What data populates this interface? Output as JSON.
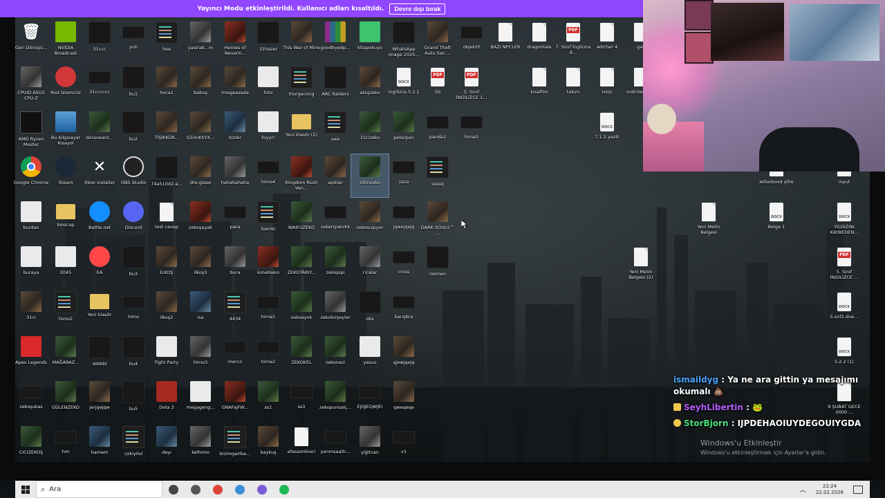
{
  "banner": {
    "text": "Yayıncı Modu etkinleştirildi. Kullanıcı adları kısaltıldı.",
    "button": "Devre dışı bırak"
  },
  "colors": {
    "banner": "#9146ff",
    "taskbar": "#e9e9ea"
  },
  "desktop": {
    "icons": [
      {
        "label": "Geri Dönüşü...",
        "icon": "recycle-bin-icon",
        "type": "recycle"
      },
      {
        "label": "NVIDIA Broadcast",
        "icon": "nvidia-icon",
        "type": "nvidia"
      },
      {
        "label": "31ccc",
        "icon": "image-icon",
        "type": "dark"
      },
      {
        "label": "yuh",
        "icon": "image-icon",
        "type": "small"
      },
      {
        "label": "hee",
        "icon": "image-icon",
        "type": "code"
      },
      {
        "label": "yasirab...m",
        "icon": "image-icon",
        "type": "gray"
      },
      {
        "label": "Heroes of Neverti...",
        "icon": "game-icon",
        "type": "red"
      },
      {
        "label": "31hazer",
        "icon": "image-icon",
        "type": "dark"
      },
      {
        "label": "This War of Mine",
        "icon": "game-icon",
        "type": "photo"
      },
      {
        "label": "goodbyedp...",
        "icon": "archive-icon",
        "type": "rar"
      },
      {
        "label": "kitapokuyo",
        "icon": "image-icon",
        "type": "green2"
      },
      {
        "label": "WhatsApp Image 2025...",
        "icon": "image-icon",
        "type": "dark"
      },
      {
        "label": "Grand Theft Auto San ...",
        "icon": "game-icon",
        "type": "photo"
      },
      {
        "label": "objektif",
        "icon": "image-icon",
        "type": "small"
      },
      {
        "label": "BAZI NPCLER",
        "icon": "document-icon",
        "type": "doc"
      },
      {
        "label": "dragontale",
        "icon": "document-icon",
        "type": "doc"
      },
      {
        "label": "7. Sınıf İngilizce 8...",
        "icon": "pdf-icon",
        "type": "pdf"
      },
      {
        "label": "witcher 4",
        "icon": "document-icon",
        "type": "doc"
      },
      {
        "label": "gay",
        "icon": "document-icon",
        "type": "doc"
      },
      {
        "label": "CPUID ASUS CPU-Z",
        "icon": "cpuz-icon",
        "type": "gray"
      },
      {
        "label": "Riot İstemcisi",
        "icon": "riot-icon",
        "type": "riot"
      },
      {
        "label": "31cccccc",
        "icon": "image-icon",
        "type": "small"
      },
      {
        "label": "bu1",
        "icon": "image-icon",
        "type": "dark"
      },
      {
        "label": "hoca1",
        "icon": "image-icon",
        "type": "photo"
      },
      {
        "label": "babuş",
        "icon": "image-icon",
        "type": "photo"
      },
      {
        "label": "imageasada",
        "icon": "image-icon",
        "type": "photo"
      },
      {
        "label": "foto",
        "icon": "image-icon",
        "type": "white"
      },
      {
        "label": "thorgecmig",
        "icon": "image-icon",
        "type": "code"
      },
      {
        "label": "ARC Raiders",
        "icon": "game-icon",
        "type": "dark"
      },
      {
        "label": "ateşzeko",
        "icon": "image-icon",
        "type": "photo"
      },
      {
        "label": "ingilizce.5.2.1",
        "icon": "docx-icon",
        "type": "docx"
      },
      {
        "label": "5b",
        "icon": "pdf-icon",
        "type": "pdf"
      },
      {
        "label": "5. Sınıf İNGİLİZCE 1...",
        "icon": "pdf-icon",
        "type": "pdf"
      },
      {
        "label": "kısafilm",
        "icon": "document-icon",
        "type": "doc"
      },
      {
        "label": "takım",
        "icon": "document-icon",
        "type": "doc"
      },
      {
        "label": "lolrp",
        "icon": "document-icon",
        "type": "doc"
      },
      {
        "label": "indirilen liste",
        "icon": "document-icon",
        "type": "doc"
      },
      {
        "label": "AMD Ryzen Master",
        "icon": "amd-icon",
        "type": "amd"
      },
      {
        "label": "Bu bilgisayar Kısayol",
        "icon": "computer-icon",
        "type": "bluebar"
      },
      {
        "label": "doraveant...",
        "icon": "image-icon",
        "type": "green"
      },
      {
        "label": "bu2",
        "icon": "image-icon",
        "type": "dark"
      },
      {
        "label": "TİŞİKKÜR...",
        "icon": "image-icon",
        "type": "photo"
      },
      {
        "label": "G50nKhYX...",
        "icon": "image-icon",
        "type": "photo"
      },
      {
        "label": "bizler",
        "icon": "image-icon",
        "type": "blue"
      },
      {
        "label": "foyyr!",
        "icon": "image-icon",
        "type": "white"
      },
      {
        "label": "Yeni klasör (2)",
        "icon": "folder-icon",
        "type": "folder"
      },
      {
        "label": "aaa",
        "icon": "image-icon",
        "type": "code"
      },
      {
        "label": "31cizeko",
        "icon": "image-icon",
        "type": "green"
      },
      {
        "label": "peterpan",
        "icon": "image-icon",
        "type": "green"
      },
      {
        "label": "panda1",
        "icon": "image-icon",
        "type": "small"
      },
      {
        "label": "hima5",
        "icon": "image-icon",
        "type": "small"
      },
      {
        "label": "7.1.2.yazili",
        "icon": "docx-icon",
        "type": "docx"
      },
      {
        "label": "Google Chrome",
        "icon": "chrome-icon",
        "type": "chrome"
      },
      {
        "label": "Steam",
        "icon": "steam-icon",
        "type": "steam"
      },
      {
        "label": "Xbox installer",
        "icon": "xbox-icon",
        "type": "xbox"
      },
      {
        "label": "OBS Studio",
        "icon": "obs-icon",
        "type": "obs"
      },
      {
        "label": "74a510d2-a...",
        "icon": "image-icon",
        "type": "dark"
      },
      {
        "label": "dre-glase",
        "icon": "image-icon",
        "type": "photo"
      },
      {
        "label": "hahahahaha",
        "icon": "image-icon",
        "type": "gray"
      },
      {
        "label": "himo4",
        "icon": "image-icon",
        "type": "small"
      },
      {
        "label": "Kingdom Rush Ven...",
        "icon": "game-icon",
        "type": "red"
      },
      {
        "label": "aşıklar",
        "icon": "image-icon",
        "type": "photo"
      },
      {
        "label": "zibinzeko",
        "icon": "image-icon",
        "type": "green",
        "selected": true
      },
      {
        "label": "zaza",
        "icon": "image-icon",
        "type": "small"
      },
      {
        "label": "ssssq",
        "icon": "image-icon",
        "type": "code"
      },
      {
        "label": "letterboxd şifre",
        "icon": "document-icon",
        "type": "doc"
      },
      {
        "label": "input",
        "icon": "document-icon",
        "type": "doc"
      },
      {
        "label": "burdan",
        "icon": "image-icon",
        "type": "white"
      },
      {
        "label": "bioscap",
        "icon": "folder-icon",
        "type": "folder"
      },
      {
        "label": "Battle.net",
        "icon": "battlenet-icon",
        "type": "battle"
      },
      {
        "label": "Discord",
        "icon": "discord-icon",
        "type": "discord"
      },
      {
        "label": "test cevap",
        "icon": "document-icon",
        "type": "doc"
      },
      {
        "label": "zekoşayak",
        "icon": "image-icon",
        "type": "red"
      },
      {
        "label": "para",
        "icon": "image-icon",
        "type": "small"
      },
      {
        "label": "bambi",
        "icon": "image-icon",
        "type": "code"
      },
      {
        "label": "WAIFUZEKO",
        "icon": "image-icon",
        "type": "green"
      },
      {
        "label": "zekeriyakvkk",
        "icon": "image-icon",
        "type": "small"
      },
      {
        "label": "zekosuipyor",
        "icon": "image-icon",
        "type": "photo"
      },
      {
        "label": "jqwejqejq",
        "icon": "image-icon",
        "type": "small"
      },
      {
        "label": "DARK SOULS™ ...",
        "icon": "game-icon",
        "type": "photo"
      },
      {
        "label": "Yeni Metin Belgesi",
        "icon": "document-icon",
        "type": "doc"
      },
      {
        "label": "Belge 1",
        "icon": "docx-icon",
        "type": "docx"
      },
      {
        "label": "YILDIZINI KAYBEDEN...",
        "icon": "docx-icon",
        "type": "docx"
      },
      {
        "label": "buraya",
        "icon": "image-icon",
        "type": "white"
      },
      {
        "label": "2045",
        "icon": "image-icon",
        "type": "white"
      },
      {
        "label": "EA",
        "icon": "ea-icon",
        "type": "ea"
      },
      {
        "label": "bu3",
        "icon": "image-icon",
        "type": "dark"
      },
      {
        "label": "İLKOŞ",
        "icon": "image-icon",
        "type": "photo"
      },
      {
        "label": "ilkoş3",
        "icon": "image-icon",
        "type": "photo"
      },
      {
        "label": "bura",
        "icon": "image-icon",
        "type": "gray"
      },
      {
        "label": "ismebakın",
        "icon": "image-icon",
        "type": "red"
      },
      {
        "label": "ZEKOTARIY...",
        "icon": "image-icon",
        "type": "green"
      },
      {
        "label": "zekopipi",
        "icon": "image-icon",
        "type": "green"
      },
      {
        "label": "ricalar",
        "icon": "image-icon",
        "type": "gray"
      },
      {
        "label": "cross",
        "icon": "image-icon",
        "type": "small"
      },
      {
        "label": "resmen",
        "icon": "image-icon",
        "type": "dark"
      },
      {
        "label": "Yeni Metin Belgesi (2)",
        "icon": "document-icon",
        "type": "doc"
      },
      {
        "label": "5. Sınıf İNGİLİZCE ...",
        "icon": "pdf-icon",
        "type": "pdf"
      },
      {
        "label": "31ci",
        "icon": "image-icon",
        "type": "photo"
      },
      {
        "label": "himo2",
        "icon": "image-icon",
        "type": "code"
      },
      {
        "label": "Yeni klasör",
        "icon": "folder-icon",
        "type": "folder"
      },
      {
        "label": "himo",
        "icon": "image-icon",
        "type": "small"
      },
      {
        "label": "ilkoş2",
        "icon": "image-icon",
        "type": "photo"
      },
      {
        "label": "isa",
        "icon": "image-icon",
        "type": "blue"
      },
      {
        "label": "4434",
        "icon": "image-icon",
        "type": "code"
      },
      {
        "label": "hima1",
        "icon": "image-icon",
        "type": "small"
      },
      {
        "label": "zekoaynk",
        "icon": "image-icon",
        "type": "green"
      },
      {
        "label": "zekobirşeyler",
        "icon": "image-icon",
        "type": "gray"
      },
      {
        "label": "obs",
        "icon": "image-icon",
        "type": "dark"
      },
      {
        "label": "barışbra",
        "icon": "image-icon",
        "type": "small"
      },
      {
        "label": "5.snf2.dne...",
        "icon": "docx-icon",
        "type": "docx"
      },
      {
        "label": "Apex Legends",
        "icon": "apex-icon",
        "type": "apex"
      },
      {
        "label": "MAĞARAZ...",
        "icon": "image-icon",
        "type": "green"
      },
      {
        "label": "ddddd",
        "icon": "image-icon",
        "type": "dark"
      },
      {
        "label": "bu4",
        "icon": "image-icon",
        "type": "dark"
      },
      {
        "label": "Fight Party",
        "icon": "game-icon",
        "type": "white"
      },
      {
        "label": "himo3",
        "icon": "image-icon",
        "type": "gray"
      },
      {
        "label": "merco",
        "icon": "image-icon",
        "type": "small"
      },
      {
        "label": "hima2",
        "icon": "image-icon",
        "type": "small"
      },
      {
        "label": "ZEKOKEL",
        "icon": "image-icon",
        "type": "green"
      },
      {
        "label": "zekonazi",
        "icon": "image-icon",
        "type": "green"
      },
      {
        "label": "yasuo",
        "icon": "image-icon",
        "type": "white"
      },
      {
        "label": "qjewjqejq",
        "icon": "image-icon",
        "type": "photo"
      },
      {
        "label": "5.2.2 (1)",
        "icon": "docx-icon",
        "type": "docx"
      },
      {
        "label": "zekoşukas",
        "icon": "image-icon",
        "type": "small"
      },
      {
        "label": "GÜLENZEKO",
        "icon": "image-icon",
        "type": "green"
      },
      {
        "label": "jerjqejqw",
        "icon": "image-icon",
        "type": "photo"
      },
      {
        "label": "bu5",
        "icon": "image-icon",
        "type": "dark"
      },
      {
        "label": "Dota 2",
        "icon": "dota-icon",
        "type": "dota"
      },
      {
        "label": "megageng...",
        "icon": "image-icon",
        "type": "white"
      },
      {
        "label": "GRAFajFW...",
        "icon": "image-icon",
        "type": "red"
      },
      {
        "label": "ss1",
        "icon": "image-icon",
        "type": "green"
      },
      {
        "label": "ss3",
        "icon": "image-icon",
        "type": "small"
      },
      {
        "label": "zekopunsalç...",
        "icon": "image-icon",
        "type": "green"
      },
      {
        "label": "EJQJEQWJEI",
        "icon": "image-icon",
        "type": "small"
      },
      {
        "label": "qweqeqe",
        "icon": "image-icon",
        "type": "photo"
      },
      {
        "label": "9 ŞUBAT GECE 0000 ...",
        "icon": "document-icon",
        "type": "doc"
      },
      {
        "label": "CICIZEKOŞ",
        "icon": "image-icon",
        "type": "green"
      },
      {
        "label": "hm",
        "icon": "image-icon",
        "type": "small"
      },
      {
        "label": "hamam",
        "icon": "image-icon",
        "type": "blue"
      },
      {
        "label": "çokiyilol",
        "icon": "image-icon",
        "type": "code"
      },
      {
        "label": "dayı",
        "icon": "image-icon",
        "type": "blue"
      },
      {
        "label": "kelhimo",
        "icon": "image-icon",
        "type": "gray"
      },
      {
        "label": "bizimgariba...",
        "icon": "image-icon",
        "type": "code"
      },
      {
        "label": "baykuş",
        "icon": "image-icon",
        "type": "photo"
      },
      {
        "label": "efesamöneri",
        "icon": "document-icon",
        "type": "doc"
      },
      {
        "label": "yarımsaattı...",
        "icon": "image-icon",
        "type": "small"
      },
      {
        "label": "yiğitcan",
        "icon": "image-icon",
        "type": "gray"
      },
      {
        "label": "v1",
        "icon": "image-icon",
        "type": "small"
      }
    ]
  },
  "chat": [
    {
      "user": "ismaildyg",
      "message": "Ya ne ara gittin ya mesajımı okumalı 💩",
      "badge": ""
    },
    {
      "user": "SeyhLibertin",
      "message": "🐸",
      "badge": "#f2c94c"
    },
    {
      "user": "StorBjorn",
      "message": "IJPDEHAOIUYDEGOUIYGDA",
      "badge": "#f2c94c"
    }
  ],
  "activation": {
    "title": "Windows'u Etkinleştir",
    "subtitle": "Windows'u etkinleştirmek için Ayarlar'a gidin."
  },
  "taskbar": {
    "search_placeholder": "Ara",
    "apps": [
      {
        "icon": "task-view-icon",
        "color": "#444444"
      },
      {
        "icon": "app-icon",
        "color": "#555555"
      },
      {
        "icon": "chrome-icon",
        "color": "#db4437"
      },
      {
        "icon": "settings-app-icon",
        "color": "#3a8fd8"
      },
      {
        "icon": "discord-obs-icon",
        "color": "#7b5cd6"
      },
      {
        "icon": "spotify-icon",
        "color": "#1db954"
      }
    ],
    "time": "22:24",
    "date": "22.02.2026"
  }
}
